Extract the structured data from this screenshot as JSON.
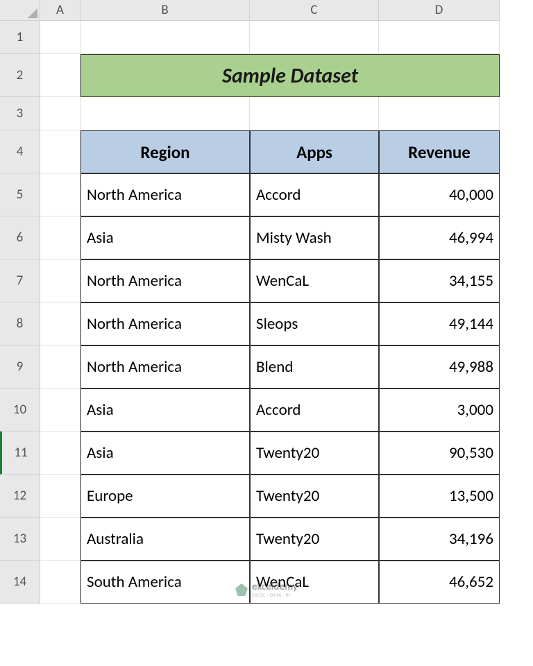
{
  "columns": [
    "A",
    "B",
    "C",
    "D"
  ],
  "rows": [
    "1",
    "2",
    "3",
    "4",
    "5",
    "6",
    "7",
    "8",
    "9",
    "10",
    "11",
    "12",
    "13",
    "14"
  ],
  "selected_row": "11",
  "title": "Sample Dataset",
  "headers": {
    "region": "Region",
    "apps": "Apps",
    "revenue": "Revenue"
  },
  "data": [
    {
      "region": "North America",
      "apps": "Accord",
      "revenue": "40,000"
    },
    {
      "region": "Asia",
      "apps": "Misty Wash",
      "revenue": "46,994"
    },
    {
      "region": "North America",
      "apps": "WenCaL",
      "revenue": "34,155"
    },
    {
      "region": "North America",
      "apps": "Sleops",
      "revenue": "49,144"
    },
    {
      "region": "North America",
      "apps": "Blend",
      "revenue": "49,988"
    },
    {
      "region": "Asia",
      "apps": "Accord",
      "revenue": "3,000"
    },
    {
      "region": "Asia",
      "apps": "Twenty20",
      "revenue": "90,530"
    },
    {
      "region": "Europe",
      "apps": "Twenty20",
      "revenue": "13,500"
    },
    {
      "region": "Australia",
      "apps": "Twenty20",
      "revenue": "34,196"
    },
    {
      "region": "South America",
      "apps": "WenCaL",
      "revenue": "46,652"
    }
  ],
  "watermark": {
    "name": "exceldemy",
    "sub": "EXCEL · DATA · BI"
  },
  "chart_data": {
    "type": "table",
    "title": "Sample Dataset",
    "columns": [
      "Region",
      "Apps",
      "Revenue"
    ],
    "rows": [
      [
        "North America",
        "Accord",
        40000
      ],
      [
        "Asia",
        "Misty Wash",
        46994
      ],
      [
        "North America",
        "WenCaL",
        34155
      ],
      [
        "North America",
        "Sleops",
        49144
      ],
      [
        "North America",
        "Blend",
        49988
      ],
      [
        "Asia",
        "Accord",
        3000
      ],
      [
        "Asia",
        "Twenty20",
        90530
      ],
      [
        "Europe",
        "Twenty20",
        13500
      ],
      [
        "Australia",
        "Twenty20",
        34196
      ],
      [
        "South America",
        "WenCaL",
        46652
      ]
    ]
  }
}
